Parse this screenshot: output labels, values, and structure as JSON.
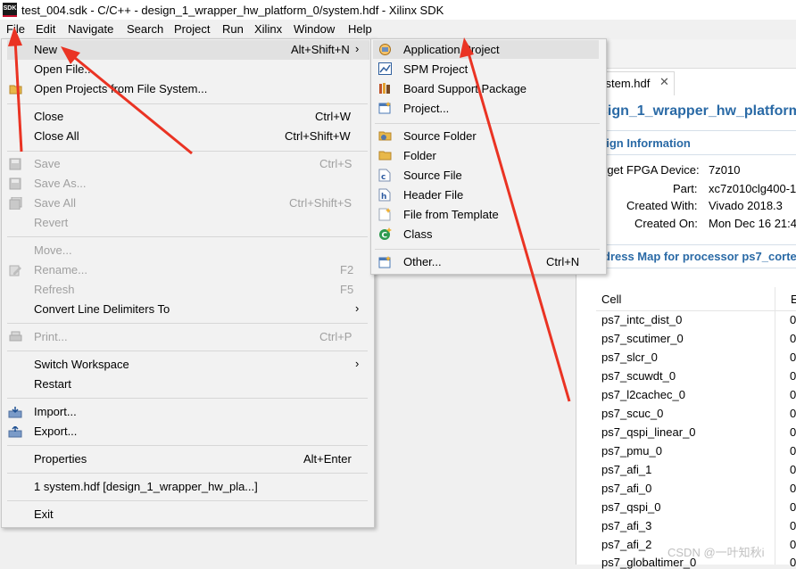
{
  "window": {
    "title": "test_004.sdk - C/C++ - design_1_wrapper_hw_platform_0/system.hdf - Xilinx SDK",
    "icon_label": "SDK"
  },
  "menubar": [
    "File",
    "Edit",
    "Navigate",
    "Search",
    "Project",
    "Run",
    "Xilinx",
    "Window",
    "Help"
  ],
  "file_menu": {
    "new": {
      "label": "New",
      "accel": "Alt+Shift+N"
    },
    "open_file": {
      "label": "Open File..."
    },
    "open_projects": {
      "label": "Open Projects from File System..."
    },
    "close": {
      "label": "Close",
      "accel": "Ctrl+W"
    },
    "close_all": {
      "label": "Close All",
      "accel": "Ctrl+Shift+W"
    },
    "save": {
      "label": "Save",
      "accel": "Ctrl+S"
    },
    "save_as": {
      "label": "Save As..."
    },
    "save_all": {
      "label": "Save All",
      "accel": "Ctrl+Shift+S"
    },
    "revert": {
      "label": "Revert"
    },
    "move": {
      "label": "Move..."
    },
    "rename": {
      "label": "Rename...",
      "accel": "F2"
    },
    "refresh": {
      "label": "Refresh",
      "accel": "F5"
    },
    "convert": {
      "label": "Convert Line Delimiters To"
    },
    "print": {
      "label": "Print...",
      "accel": "Ctrl+P"
    },
    "switch_ws": {
      "label": "Switch Workspace"
    },
    "restart": {
      "label": "Restart"
    },
    "import": {
      "label": "Import..."
    },
    "export": {
      "label": "Export..."
    },
    "properties": {
      "label": "Properties",
      "accel": "Alt+Enter"
    },
    "recent": {
      "label": "1 system.hdf  [design_1_wrapper_hw_pla...]"
    },
    "exit": {
      "label": "Exit"
    }
  },
  "new_submenu": {
    "app_project": "Application Project",
    "spm_project": "SPM Project",
    "bsp": "Board Support Package",
    "project": "Project...",
    "source_folder": "Source Folder",
    "folder": "Folder",
    "source_file": "Source File",
    "header_file": "Header File",
    "file_from_template": "File from Template",
    "class": "Class",
    "other": {
      "label": "Other...",
      "accel": "Ctrl+N"
    }
  },
  "editor": {
    "tab_label": "ystem.hdf",
    "heading": "sign_1_wrapper_hw_platform",
    "design_info_title": "sign Information",
    "fields": [
      {
        "key": "rget FPGA Device:",
        "value": "7z010"
      },
      {
        "key": "Part:",
        "value": "xc7z010clg400-1"
      },
      {
        "key": "Created With:",
        "value": "Vivado 2018.3"
      },
      {
        "key": "Created On:",
        "value": "Mon Dec 16 21:4"
      }
    ],
    "address_map_title": "dress Map for processor ps7_cortex",
    "table_header": "Cell",
    "table_header2": "E",
    "cells": [
      {
        "name": "ps7_intc_dist_0",
        "v": "0"
      },
      {
        "name": "ps7_scutimer_0",
        "v": "0"
      },
      {
        "name": "ps7_slcr_0",
        "v": "0"
      },
      {
        "name": "ps7_scuwdt_0",
        "v": "0"
      },
      {
        "name": "ps7_l2cachec_0",
        "v": "0"
      },
      {
        "name": "ps7_scuc_0",
        "v": "0"
      },
      {
        "name": "ps7_qspi_linear_0",
        "v": "0"
      },
      {
        "name": "ps7_pmu_0",
        "v": "0"
      },
      {
        "name": "ps7_afi_1",
        "v": "0"
      },
      {
        "name": "ps7_afi_0",
        "v": "0"
      },
      {
        "name": "ps7_qspi_0",
        "v": "0"
      },
      {
        "name": "ps7_afi_3",
        "v": "0"
      },
      {
        "name": "ps7_afi_2",
        "v": "0"
      },
      {
        "name": "ps7_globaltimer_0",
        "v": "0"
      }
    ]
  },
  "watermark": "CSDN @一叶知秋i",
  "colors": {
    "accent_blue": "#2a6aa6",
    "arrow_red": "#ea3323",
    "menu_bg": "#f2f2f2"
  }
}
